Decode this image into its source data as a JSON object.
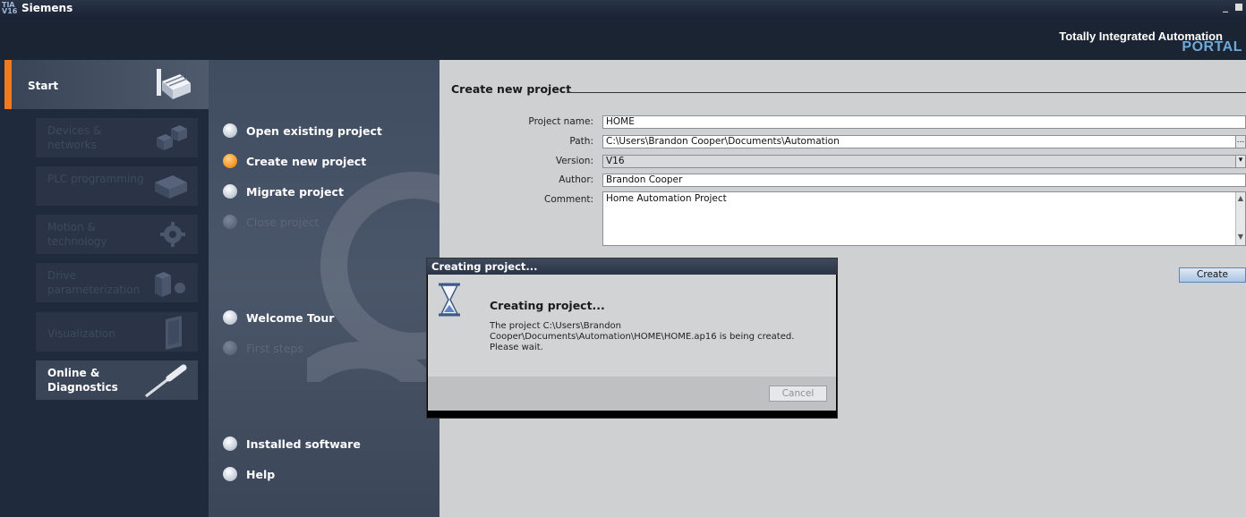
{
  "titlebar": {
    "logo_line1": "TIA",
    "logo_line2": "V16",
    "title": "Siemens",
    "minimize": "_"
  },
  "header": {
    "brand_line1": "Totally Integrated Automation",
    "brand_line2": "PORTAL"
  },
  "sidebar": {
    "start_label": "Start",
    "items": [
      {
        "label": "Devices & networks",
        "enabled": false
      },
      {
        "label": "PLC programming",
        "enabled": false
      },
      {
        "label": "Motion & technology",
        "enabled": false
      },
      {
        "label": "Drive parameterization",
        "enabled": false
      },
      {
        "label": "Visualization",
        "enabled": false
      },
      {
        "label": "Online & Diagnostics",
        "enabled": true
      }
    ]
  },
  "menu": {
    "items": [
      {
        "label": "Open existing project",
        "state": "normal"
      },
      {
        "label": "Create new project",
        "state": "active"
      },
      {
        "label": "Migrate project",
        "state": "normal"
      },
      {
        "label": "Close project",
        "state": "disabled"
      },
      {
        "label": "Welcome Tour",
        "state": "normal"
      },
      {
        "label": "First steps",
        "state": "disabled"
      },
      {
        "label": "Installed software",
        "state": "normal"
      },
      {
        "label": "Help",
        "state": "normal"
      }
    ]
  },
  "form": {
    "section_title": "Create new project",
    "project_name_label": "Project name:",
    "project_name_value": "HOME",
    "path_label": "Path:",
    "path_value": "C:\\Users\\Brandon Cooper\\Documents\\Automation",
    "path_browse": "...",
    "version_label": "Version:",
    "version_value": "V16",
    "author_label": "Author:",
    "author_value": "Brandon Cooper",
    "comment_label": "Comment:",
    "comment_value": "Home Automation Project",
    "create_button": "Create"
  },
  "dialog": {
    "title": "Creating project...",
    "heading": "Creating project...",
    "message": "The project C:\\Users\\Brandon Cooper\\Documents\\Automation\\HOME\\HOME.ap16 is being created. Please wait.",
    "cancel_button": "Cancel"
  },
  "colors": {
    "accent_orange": "#f07a1c",
    "header_bg": "#1b2433",
    "portal_blue": "#6fa9d8"
  }
}
